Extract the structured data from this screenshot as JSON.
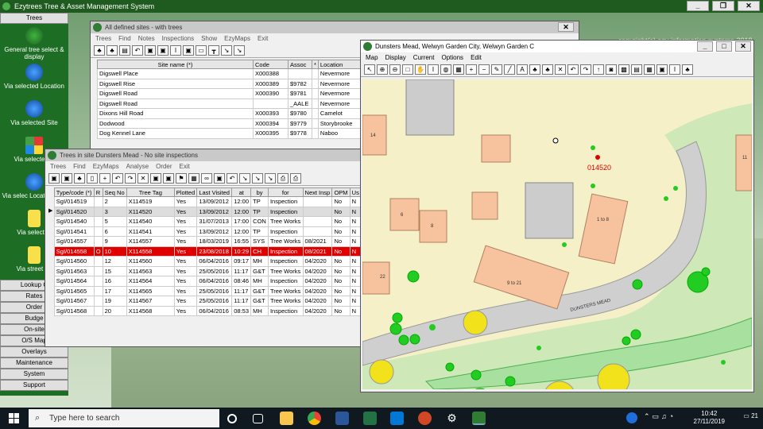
{
  "app": {
    "title": "Ezytrees Tree & Asset Management System",
    "copyright": "copyright(c) ezy information systems 2018"
  },
  "sidebar": {
    "header": "Trees",
    "items": [
      {
        "label": "General tree select & display",
        "icon": "tree-icon"
      },
      {
        "label": "Via selected Location",
        "icon": "globe-icon"
      },
      {
        "label": "Via selected Site",
        "icon": "globe-pin-icon"
      },
      {
        "label": "Via selected S",
        "icon": "rubiks-cube-icon"
      },
      {
        "label": "Via selec Location/Site",
        "icon": "globe-icon"
      },
      {
        "label": "Via selected",
        "icon": "sign-icon"
      },
      {
        "label": "Via street ga",
        "icon": "sign-icon"
      }
    ],
    "buttons": [
      "Lookup C",
      "Rates",
      "Order",
      "Budge",
      "On-site",
      "O/S Map",
      "Overlays",
      "Maintenance",
      "System",
      "Support"
    ]
  },
  "sites_window": {
    "title": "All defined sites - with trees",
    "menu": [
      "Trees",
      "Find",
      "Notes",
      "Inspections",
      "Show",
      "EzyMaps",
      "Exit"
    ],
    "columns": [
      "Site name (*)",
      "Code",
      "Assoc",
      "*",
      "Location"
    ],
    "rows": [
      [
        "Digswell Place",
        "X000388",
        "",
        "",
        "Nevermore"
      ],
      [
        "Digswell Rise",
        "X000389",
        "$9782",
        "",
        "Nevermore"
      ],
      [
        "Digswell Road",
        "X000390",
        "$9781",
        "",
        "Nevermore"
      ],
      [
        "Digswell Road",
        "",
        "_AALE",
        "",
        "Nevermore"
      ],
      [
        "Dixons Hill Road",
        "X000393",
        "$9780",
        "",
        "Camelot"
      ],
      [
        "Dodwood",
        "X000394",
        "$9779",
        "",
        "Storybrooke"
      ],
      [
        "Dog Kennel Lane",
        "X000395",
        "$9778",
        "",
        "Naboo"
      ]
    ]
  },
  "trees_window": {
    "title": "Trees in site Dunsters Mead - No site inspections",
    "menu": [
      "Trees",
      "Find",
      "EzyMaps",
      "Analyse",
      "Order",
      "Exit"
    ],
    "columns": [
      "Type/code (*)",
      "R",
      "Seq No",
      "Tree Tag",
      "Plotted",
      "Last Visited",
      "at",
      "by",
      "for",
      "Next Insp",
      "OPM",
      "Us"
    ],
    "rows": [
      [
        "SgI/014519",
        "",
        "2",
        "X114519",
        "Yes",
        "13/09/2012",
        "12:00",
        "TP",
        "Inspection",
        "",
        "No",
        "N"
      ],
      [
        "SgI/014520",
        "",
        "3",
        "X114520",
        "Yes",
        "13/09/2012",
        "12:00",
        "TP",
        "Inspection",
        "",
        "No",
        "N"
      ],
      [
        "SgI/014540",
        "",
        "5",
        "X114540",
        "Yes",
        "31/07/2013",
        "17:00",
        "CON",
        "Tree Works",
        "",
        "No",
        "N"
      ],
      [
        "SgI/014541",
        "",
        "6",
        "X114541",
        "Yes",
        "13/09/2012",
        "12:00",
        "TP",
        "Inspection",
        "",
        "No",
        "N"
      ],
      [
        "SgI/014557",
        "",
        "9",
        "X114557",
        "Yes",
        "18/03/2019",
        "16:55",
        "SYS",
        "Tree Works",
        "08/2021",
        "No",
        "N"
      ],
      [
        "SgI/014558",
        "O",
        "10",
        "X114558",
        "Yes",
        "23/08/2018",
        "10:29",
        "CH",
        "Inspection",
        "08/2021",
        "No",
        "N"
      ],
      [
        "SgI/014560",
        "",
        "12",
        "X114560",
        "Yes",
        "06/04/2016",
        "09:17",
        "MH",
        "Inspection",
        "04/2020",
        "No",
        "N"
      ],
      [
        "SgI/014563",
        "",
        "15",
        "X114563",
        "Yes",
        "25/05/2016",
        "11:17",
        "G&T",
        "Tree Works",
        "04/2020",
        "No",
        "N"
      ],
      [
        "SgI/014564",
        "",
        "16",
        "X114564",
        "Yes",
        "06/04/2016",
        "08:46",
        "MH",
        "Inspection",
        "04/2020",
        "No",
        "N"
      ],
      [
        "SgI/014565",
        "",
        "17",
        "X114565",
        "Yes",
        "25/05/2016",
        "11:17",
        "G&T",
        "Tree Works",
        "04/2020",
        "No",
        "N"
      ],
      [
        "SgI/014567",
        "",
        "19",
        "X114567",
        "Yes",
        "25/05/2016",
        "11:17",
        "G&T",
        "Tree Works",
        "04/2020",
        "No",
        "N"
      ],
      [
        "SgI/014568",
        "",
        "20",
        "X114568",
        "Yes",
        "06/04/2016",
        "08:53",
        "MH",
        "Inspection",
        "04/2020",
        "No",
        "N"
      ]
    ],
    "selected_row": 1,
    "highlighted_row": 5
  },
  "map_window": {
    "title": "Dunsters Mead, Welwyn Garden City, Welwyn Garden C",
    "menu": [
      "Map",
      "Display",
      "Current",
      "Options",
      "Edit"
    ],
    "labels": {
      "tree_id": "014520",
      "street": "DUNSTERS MEAD",
      "building_a": "9 to 21",
      "building_b": "1 to 8",
      "num_6": "6",
      "num_8": "8",
      "num_14": "14",
      "num_22": "22",
      "num_11": "11"
    }
  },
  "taskbar": {
    "search_placeholder": "Type here to search",
    "time": "10:42",
    "date": "27/11/2019",
    "notifications": "21"
  },
  "colors": {
    "sidebar": "#1d6d24",
    "highlight_row": "#e00000",
    "map_bg": "#f5f0c8",
    "building": "#f7c39e",
    "road": "#cfcfcf",
    "tree_green": "#22cc22",
    "tree_yellow": "#f2e21c"
  }
}
